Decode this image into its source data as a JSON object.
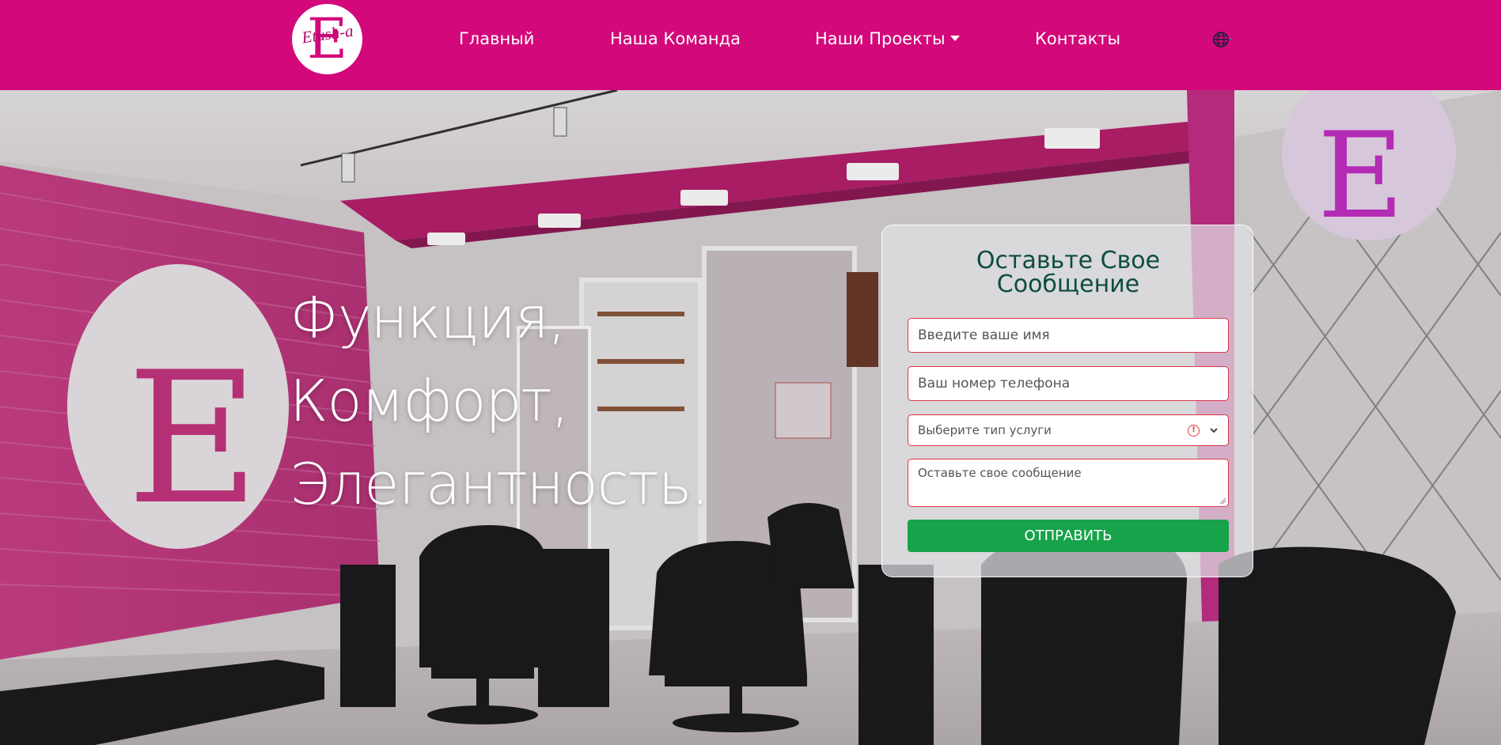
{
  "brand": {
    "logo_letter": "E",
    "logo_script": "Etush-a"
  },
  "nav": {
    "items": [
      {
        "label": "Главный"
      },
      {
        "label": "Наша Команда"
      },
      {
        "label": "Наши Проекты",
        "has_dropdown": true
      },
      {
        "label": "Контакты"
      }
    ],
    "language_icon": "globe-icon"
  },
  "hero": {
    "headline_lines": [
      "Функция,",
      "Комфорт,",
      "Элегантность."
    ]
  },
  "contact_form": {
    "title": "Оставьте Свое Сообщение",
    "name_placeholder": "Введите ваше имя",
    "phone_placeholder": "Ваш номер телефона",
    "service_placeholder": "Выберите тип услуги",
    "message_placeholder": "Оставьте свое сообщение",
    "submit_label": "ОТПРАВИТЬ"
  },
  "colors": {
    "brand_magenta": "#d3087a",
    "submit_green": "#17a34a",
    "title_green": "#0d4d3e",
    "invalid_border": "#dc3545"
  }
}
